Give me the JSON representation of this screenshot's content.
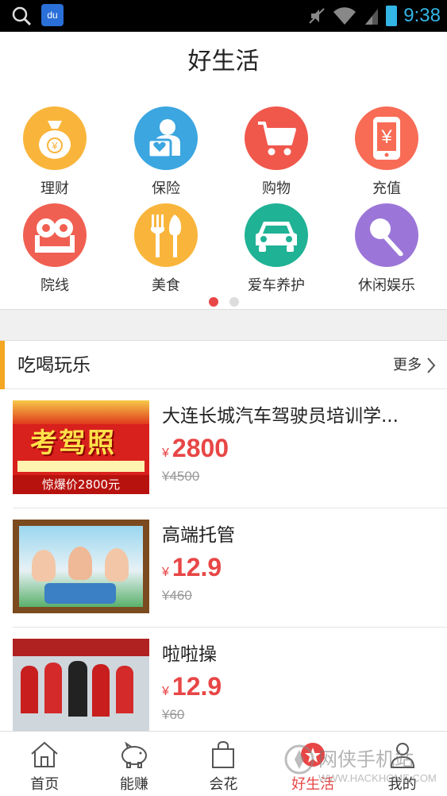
{
  "status_bar": {
    "time": "9:38",
    "baidu_badge": "du",
    "accent": "#33b5e5"
  },
  "header": {
    "title": "好生活"
  },
  "categories": [
    {
      "label": "理财",
      "icon": "money-bag-icon",
      "color": "#f9b53b"
    },
    {
      "label": "保险",
      "icon": "insurance-person-icon",
      "color": "#3ba6e0"
    },
    {
      "label": "购物",
      "icon": "shopping-cart-icon",
      "color": "#f0584c"
    },
    {
      "label": "充值",
      "icon": "phone-recharge-icon",
      "color": "#f86c56"
    },
    {
      "label": "院线",
      "icon": "cinema-icon",
      "color": "#f06052"
    },
    {
      "label": "美食",
      "icon": "fork-knife-icon",
      "color": "#f9b53b"
    },
    {
      "label": "爱车养护",
      "icon": "car-icon",
      "color": "#1fb295"
    },
    {
      "label": "休闲娱乐",
      "icon": "microphone-icon",
      "color": "#9b76d8"
    }
  ],
  "section": {
    "title": "吃喝玩乐",
    "more_label": "更多",
    "accent": "#f5a623"
  },
  "deals": [
    {
      "name": "大连长城汽车驾驶员培训学...",
      "currency": "¥",
      "price": "2800",
      "original_price": "¥4500",
      "thumb_caption": "惊爆价2800元",
      "thumb_headline": "考驾照"
    },
    {
      "name": "高端托管",
      "currency": "¥",
      "price": "12.9",
      "original_price": "¥460"
    },
    {
      "name": "啦啦操",
      "currency": "¥",
      "price": "12.9",
      "original_price": "¥60"
    }
  ],
  "tabs": [
    {
      "label": "首页",
      "icon": "home-icon"
    },
    {
      "label": "能赚",
      "icon": "piggy-bank-icon"
    },
    {
      "label": "会花",
      "icon": "shopping-bag-icon"
    },
    {
      "label": "好生活",
      "icon": "good-life-icon",
      "active": true
    },
    {
      "label": "我的",
      "icon": "profile-icon"
    }
  ],
  "price_color": "#e84646",
  "watermark": {
    "text": "网侠手机站",
    "url": "WWW.HACKHOME.COM"
  }
}
